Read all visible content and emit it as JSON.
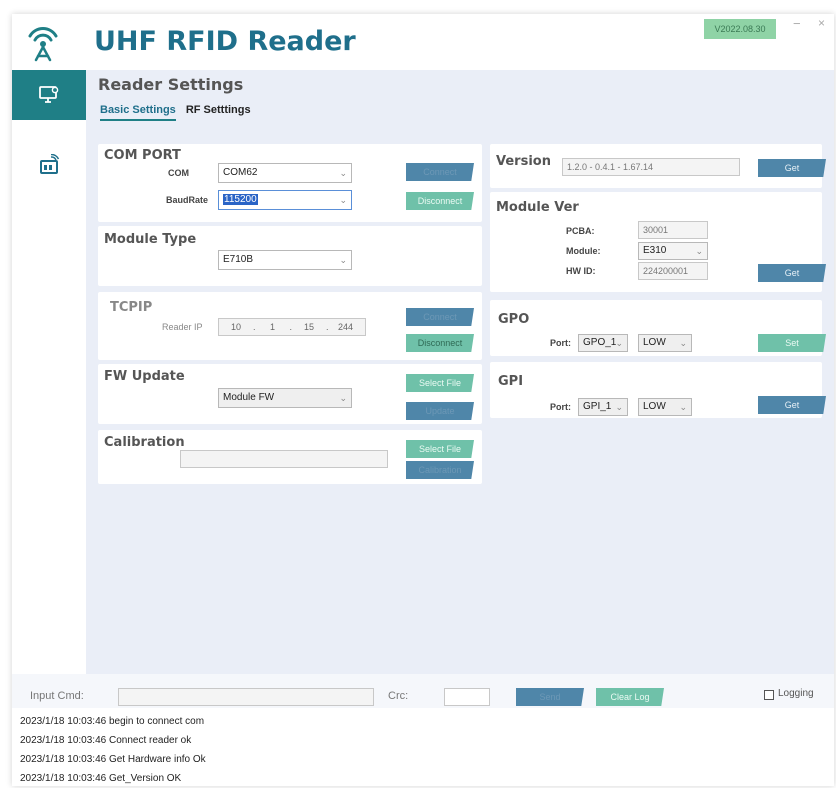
{
  "app": {
    "title": "UHF RFID Reader",
    "version_badge": "V2022.08.30",
    "minimize": "−",
    "close": "×"
  },
  "sidebar": {
    "items": [
      {
        "name": "settings",
        "icon": "monitor-settings-icon",
        "active": true
      },
      {
        "name": "inventory",
        "icon": "tag-reader-icon",
        "active": false
      }
    ]
  },
  "page": {
    "title": "Reader Settings",
    "tabs": [
      {
        "label": "Basic Settings",
        "active": true
      },
      {
        "label": "RF Setttings",
        "active": false
      }
    ]
  },
  "com_port": {
    "title": "COM PORT",
    "com_label": "COM",
    "com_value": "COM62",
    "baud_label": "BaudRate",
    "baud_value": "115200",
    "connect": "Connect",
    "disconnect": "Disconnect"
  },
  "module_type": {
    "title": "Module Type",
    "value": "E710B"
  },
  "tcpip": {
    "title": "TCPIP",
    "ip_label": "Reader IP",
    "ip": [
      "10",
      "1",
      "15",
      "244"
    ],
    "connect": "Connect",
    "disconnect": "Disconnect"
  },
  "fw_update": {
    "title": "FW Update",
    "value": "Module FW",
    "select_file": "Select File",
    "update": "Update"
  },
  "calibration": {
    "title": "Calibration",
    "file_path": "",
    "select_file": "Select File",
    "calibration": "Calibration"
  },
  "version": {
    "title": "Version",
    "value": "1.2.0 - 0.4.1 - 1.67.14",
    "get": "Get"
  },
  "module_ver": {
    "title": "Module Ver",
    "pcba_label": "PCBA:",
    "pcba_value": "30001",
    "module_label": "Module:",
    "module_value": "E310",
    "hwid_label": "HW ID:",
    "hwid_value": "224200001",
    "get": "Get"
  },
  "gpo": {
    "title": "GPO",
    "port_label": "Port:",
    "port_value": "GPO_1",
    "level_value": "LOW",
    "set": "Set"
  },
  "gpi": {
    "title": "GPI",
    "port_label": "Port:",
    "port_value": "GPI_1",
    "level_value": "LOW",
    "get": "Get"
  },
  "command": {
    "input_label": "Input Cmd:",
    "input_value": "",
    "crc_label": "Crc:",
    "crc_value": "",
    "send": "Send",
    "clear_log": "Clear Log",
    "logging_label": "Logging",
    "logging_checked": false
  },
  "log": [
    "2023/1/18 10:03:46 begin to connect com",
    "2023/1/18 10:03:46 Connect reader ok",
    "2023/1/18 10:03:46 Get Hardware info Ok",
    "2023/1/18 10:03:46 Get_Version OK"
  ],
  "colors": {
    "brand": "#1f6f8b",
    "accent": "#1f7f86",
    "button_blue": "#4f86a9",
    "button_green": "#6fc1a9",
    "background": "#eaeef7"
  }
}
